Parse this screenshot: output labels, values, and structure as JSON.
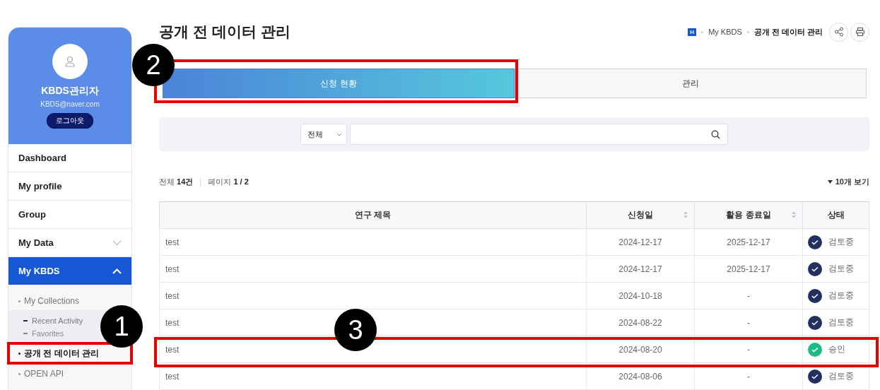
{
  "profile": {
    "name": "KBDS관리자",
    "email": "KBDS@naver.com",
    "logout": "로그아웃"
  },
  "menu": [
    {
      "label": "Dashboard",
      "selected": false,
      "kind": "link"
    },
    {
      "label": "My profile",
      "selected": false,
      "kind": "link"
    },
    {
      "label": "Group",
      "selected": false,
      "kind": "link"
    },
    {
      "label": "My Data",
      "selected": false,
      "kind": "group",
      "expanded": false
    },
    {
      "label": "My KBDS",
      "selected": true,
      "kind": "group",
      "expanded": true,
      "children": [
        {
          "label": "My Collections",
          "selected": false,
          "children": [
            {
              "label": "Recent Activity",
              "selected": true
            },
            {
              "label": "Favorites",
              "selected": false
            }
          ]
        },
        {
          "label": "공개 전 데이터 관리",
          "selected": true
        },
        {
          "label": "OPEN API",
          "selected": false
        }
      ]
    }
  ],
  "page_title": "공개 전 데이터 관리",
  "breadcrumb": [
    "H",
    "My KBDS",
    "공개 전 데이터 관리"
  ],
  "tabs": [
    {
      "label": "신청 현황",
      "selected": true
    },
    {
      "label": "관리",
      "selected": false
    }
  ],
  "search": {
    "filter": "전체"
  },
  "summary": {
    "total_label": "전체",
    "total": "14건",
    "page_label": "페이지",
    "page": "1 / 2",
    "page_size": "10개 보기"
  },
  "table": {
    "columns": [
      {
        "label": "연구 제목",
        "sortable": false
      },
      {
        "label": "신청일",
        "sortable": true
      },
      {
        "label": "활용 종료일",
        "sortable": true
      },
      {
        "label": "상태",
        "sortable": false
      }
    ],
    "rows": [
      {
        "title": "test",
        "applied": "2024-12-17",
        "end": "2025-12-17",
        "status": "검토중",
        "kind": "review"
      },
      {
        "title": "test",
        "applied": "2024-12-17",
        "end": "2025-12-17",
        "status": "검토중",
        "kind": "review"
      },
      {
        "title": "test",
        "applied": "2024-10-18",
        "end": "-",
        "status": "검토중",
        "kind": "review"
      },
      {
        "title": "test",
        "applied": "2024-08-22",
        "end": "-",
        "status": "검토중",
        "kind": "review"
      },
      {
        "title": "test",
        "applied": "2024-08-20",
        "end": "-",
        "status": "승인",
        "kind": "approved"
      },
      {
        "title": "test",
        "applied": "2024-08-06",
        "end": "-",
        "status": "검토중",
        "kind": "review"
      }
    ]
  },
  "callouts": [
    {
      "label": "1"
    },
    {
      "label": "2"
    },
    {
      "label": "3"
    }
  ]
}
